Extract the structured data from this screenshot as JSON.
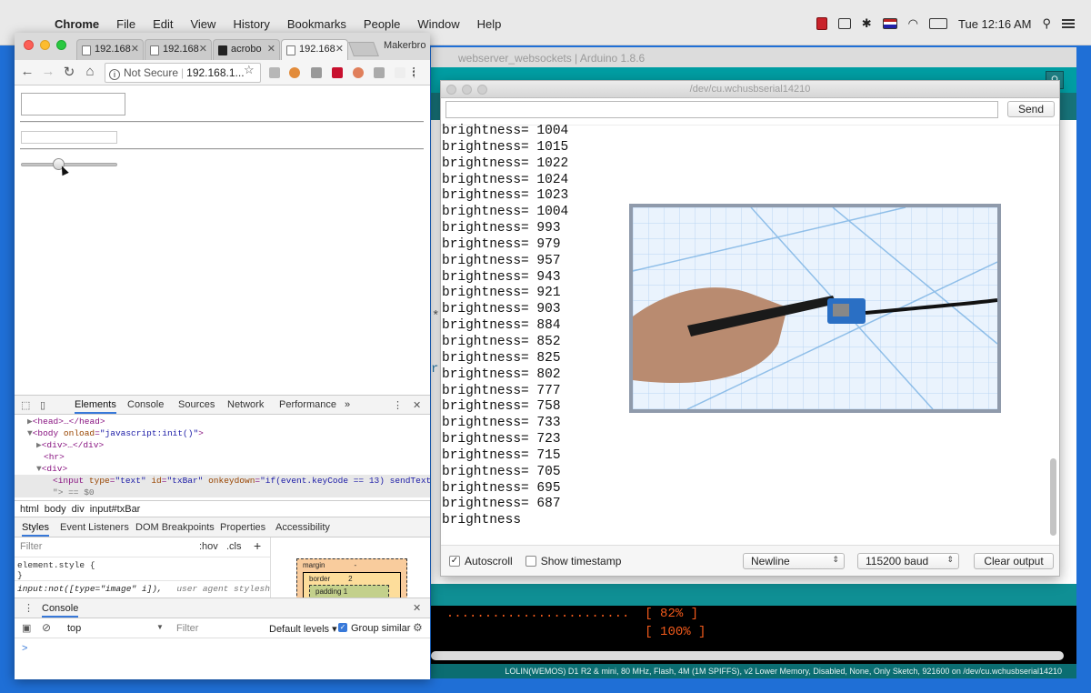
{
  "menubar": {
    "app": "Chrome",
    "items": [
      "File",
      "Edit",
      "View",
      "History",
      "Bookmarks",
      "People",
      "Window",
      "Help"
    ],
    "clock": "Tue 12:16 AM"
  },
  "arduino": {
    "title": "webserver_websockets | Arduino 1.8.6",
    "console_lines": [
      "  ........................  [ 82% ]",
      "                            [ 100% ]"
    ],
    "status_bar": "LOLIN(WEMOS) D1 R2 & mini, 80 MHz, Flash, 4M (1M SPIFFS), v2 Lower Memory, Disabled, None, Only Sketch, 921600 on /dev/cu.wchusbserial14210"
  },
  "serial": {
    "title": "/dev/cu.wchusbserial14210",
    "send_label": "Send",
    "lines": [
      "brightness= 1004",
      "brightness= 1015",
      "brightness= 1022",
      "brightness= 1024",
      "brightness= 1023",
      "brightness= 1004",
      "brightness= 993",
      "brightness= 979",
      "brightness= 957",
      "brightness= 943",
      "brightness= 921",
      "brightness= 903",
      "brightness= 884",
      "brightness= 852",
      "brightness= 825",
      "brightness= 802",
      "brightness= 777",
      "brightness= 758",
      "brightness= 733",
      "brightness= 723",
      "brightness= 715",
      "brightness= 705",
      "brightness= 695",
      "brightness= 687",
      "brightness"
    ],
    "autoscroll_label": "Autoscroll",
    "autoscroll_checked": true,
    "timestamp_label": "Show timestamp",
    "line_ending": "Newline",
    "baud": "115200 baud",
    "clear_label": "Clear output"
  },
  "chrome": {
    "tabs": [
      {
        "label": "192.168"
      },
      {
        "label": "192.168"
      },
      {
        "label": "acrobo"
      },
      {
        "label": "192.168"
      }
    ],
    "profile": "Makerbro",
    "security": "Not Secure",
    "url": "192.168.1..."
  },
  "devtools": {
    "tabs": [
      "Elements",
      "Console",
      "Sources",
      "Network",
      "Performance"
    ],
    "more": "»",
    "dom": {
      "head": "<head>…</head>",
      "body_open": "<body",
      "body_attr": "onload",
      "body_val": "\"javascript:init()\"",
      "div1": "<div>…</div>",
      "hr": "<hr>",
      "div2": "<div>",
      "input_tag": "<input",
      "input_type_attr": "type",
      "input_type_val": "\"text\"",
      "input_id_attr": "id",
      "input_id_val": "\"txBar\"",
      "input_onkey_attr": "onkeydown",
      "input_onkey_val": "\"if(event.keyCode == 13) sendText();",
      "input_tail": "\"> == $0"
    },
    "breadcrumbs": [
      "html",
      "body",
      "div",
      "input#txBar"
    ],
    "subtabs": [
      "Styles",
      "Event Listeners",
      "DOM Breakpoints",
      "Properties",
      "Accessibility"
    ],
    "filter_placeholder": "Filter",
    "hov": ":hov",
    "cls": ".cls",
    "element_style": "element.style {",
    "close_brace": "}",
    "rule_selector": "input:not([type=\"image\" i]),",
    "rule_source": "user agent stylesheet",
    "box": {
      "margin": "margin",
      "margin_val": "-",
      "border": "border",
      "border_val": "2",
      "padding": "padding 1"
    },
    "console": {
      "title": "Console",
      "context": "top",
      "filter": "Filter",
      "levels": "Default levels ▾",
      "group_similar": "Group similar",
      "prompt": ">"
    }
  }
}
